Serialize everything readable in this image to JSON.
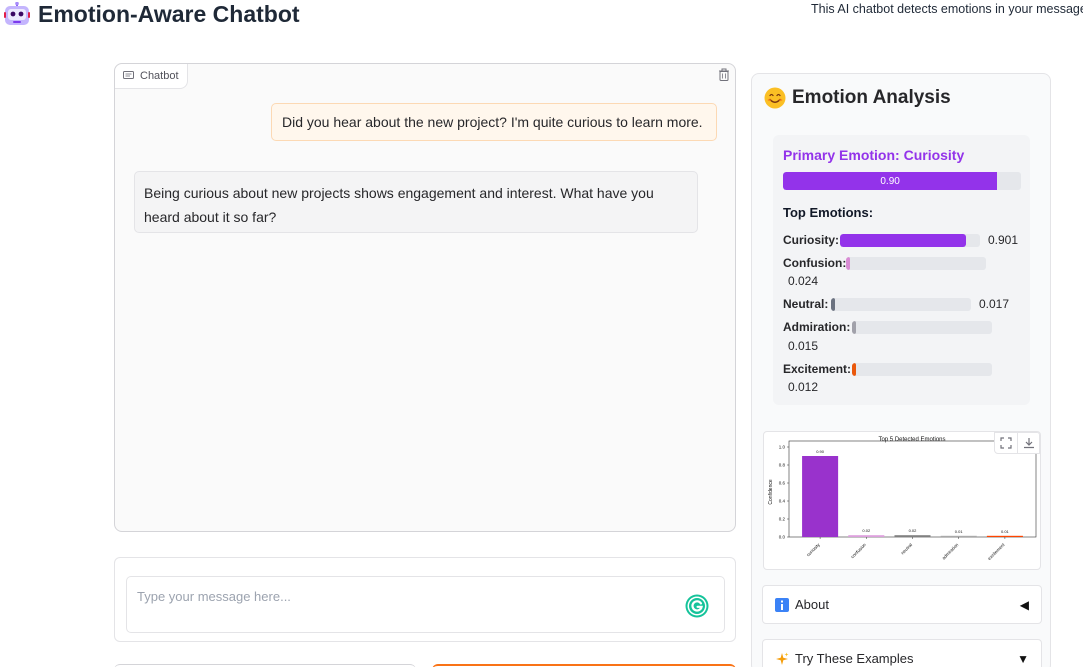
{
  "app": {
    "title": "Emotion-Aware Chatbot",
    "description": "This AI chatbot detects emotions in your messages",
    "icon": "robot-face-icon"
  },
  "chat": {
    "label": "Chatbot",
    "messages": [
      {
        "role": "user",
        "text": "Did you hear about the new project? I'm quite curious to learn more."
      },
      {
        "role": "bot",
        "text": "Being curious about new projects shows engagement and interest. What have you heard about it so far?"
      }
    ]
  },
  "input": {
    "placeholder": "Type your message here...",
    "value": ""
  },
  "analysis": {
    "title": "Emotion Analysis",
    "icon": "smiling-face-icon",
    "primary": {
      "label": "Primary Emotion: Curiosity",
      "value_label": "0.90",
      "value": 0.9
    },
    "top_label": "Top Emotions:",
    "emotions": [
      {
        "label": "Curiosity:",
        "value_label": "0.901",
        "value": 0.901,
        "color": "#9333ea"
      },
      {
        "label": "Confusion:",
        "value_label": "0.024",
        "value": 0.024,
        "color": "#d88bd4"
      },
      {
        "label": "Neutral:",
        "value_label": "0.017",
        "value": 0.017,
        "color": "#6b7280"
      },
      {
        "label": "Admiration:",
        "value_label": "0.015",
        "value": 0.015,
        "color": "#a1a1aa"
      },
      {
        "label": "Excitement:",
        "value_label": "0.012",
        "value": 0.012,
        "color": "#ea580c"
      }
    ]
  },
  "chart_data": {
    "type": "bar",
    "title": "Top 5 Detected Emotions",
    "ylabel": "Confidence",
    "xlabel": "",
    "categories": [
      "curiosity",
      "confusion",
      "neutral",
      "admiration",
      "excitement"
    ],
    "values": [
      0.9,
      0.02,
      0.02,
      0.01,
      0.01
    ],
    "value_labels": [
      "0.90",
      "0.02",
      "0.02",
      "0.01",
      "0.01"
    ],
    "colors": [
      "#9932cc",
      "#dda0dd",
      "#808080",
      "#a9a9a9",
      "#ff4500"
    ],
    "ylim": [
      0,
      1.0
    ],
    "yticks": [
      "0.0",
      "0.2",
      "0.4",
      "0.6",
      "0.8",
      "1.0"
    ],
    "grid": false
  },
  "accordions": [
    {
      "label": "About",
      "icon": "info-icon",
      "arrow": "◀"
    },
    {
      "label": "Try These Examples",
      "icon": "sparkles-icon",
      "arrow": "▼"
    }
  ]
}
